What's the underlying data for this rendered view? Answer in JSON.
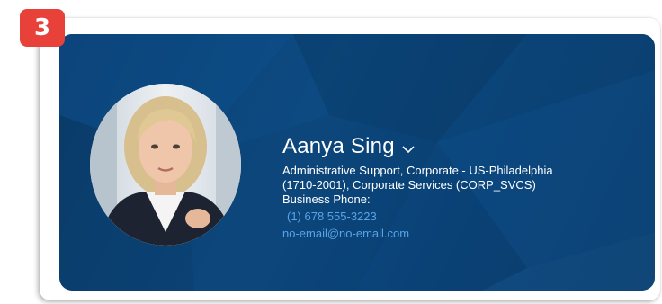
{
  "step_badge": {
    "number": "3",
    "color": "#e8413a"
  },
  "profile": {
    "name": "Aanya Sing",
    "name_menu_icon": "chevron-down-icon",
    "details_line1": "Administrative Support, Corporate - US-Philadelphia",
    "details_line2": "(1710-2001), Corporate Services (CORP_SVCS)",
    "business_phone_label": "Business Phone:",
    "business_phone": "(1) 678 555-3223",
    "email": "no-email@no-email.com"
  },
  "colors": {
    "header_background": "#0d4a82",
    "link": "#5aa3e8",
    "text": "#ffffff"
  }
}
